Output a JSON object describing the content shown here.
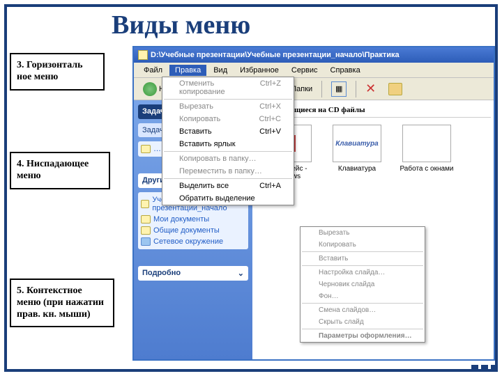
{
  "slide": {
    "title": "Виды меню",
    "callout1": "3. Горизонталь\nное меню",
    "callout2": "4. Ниспадающее меню",
    "callout3": "5. Контекстное меню (при нажатии прав. кн. мыши)"
  },
  "window": {
    "title": "D:\\Учебные презентации\\Учебные презентации_начало\\Практика",
    "menubar": [
      "Файл",
      "Правка",
      "Вид",
      "Избранное",
      "Сервис",
      "Справка"
    ],
    "toolbar": {
      "back": "Назад",
      "folders": "Папки"
    },
    "section": "Уже имеющиеся на CD файлы",
    "sidebar": {
      "task_hdr": "Задачи",
      "task_hdr2": "Задачи для файлов и папок",
      "other": "Другие места",
      "other_items": [
        "Учебные презентации_начало",
        "Мои документы",
        "Общие документы",
        "Сетевое окружение"
      ],
      "details": "Подробно"
    },
    "files": [
      {
        "name": "интерфейс - windows"
      },
      {
        "name": "Клавиатура",
        "thumb": "Клавиатура"
      },
      {
        "name": "Работа с окнами"
      }
    ]
  },
  "dropdown": [
    {
      "l": "Отменить копирование",
      "s": "Ctrl+Z",
      "en": false
    },
    {
      "sep": true
    },
    {
      "l": "Вырезать",
      "s": "Ctrl+X",
      "en": false
    },
    {
      "l": "Копировать",
      "s": "Ctrl+C",
      "en": false
    },
    {
      "l": "Вставить",
      "s": "Ctrl+V",
      "en": true
    },
    {
      "l": "Вставить ярлык",
      "s": "",
      "en": true
    },
    {
      "sep": true
    },
    {
      "l": "Копировать в папку…",
      "s": "",
      "en": false
    },
    {
      "l": "Переместить в папку…",
      "s": "",
      "en": false
    },
    {
      "sep": true
    },
    {
      "l": "Выделить все",
      "s": "Ctrl+A",
      "en": true
    },
    {
      "l": "Обратить выделение",
      "s": "",
      "en": true
    }
  ],
  "context": [
    {
      "l": "Вырезать"
    },
    {
      "l": "Копировать"
    },
    {
      "sep": true
    },
    {
      "l": "Вставить"
    },
    {
      "sep": true
    },
    {
      "l": "Настройка слайда…"
    },
    {
      "l": "Черновик слайда"
    },
    {
      "l": "Фон…"
    },
    {
      "sep": true
    },
    {
      "l": "Смена слайдов…"
    },
    {
      "l": "Скрыть слайд"
    },
    {
      "sep": true
    },
    {
      "l": "Параметры оформления…",
      "b": true
    }
  ]
}
